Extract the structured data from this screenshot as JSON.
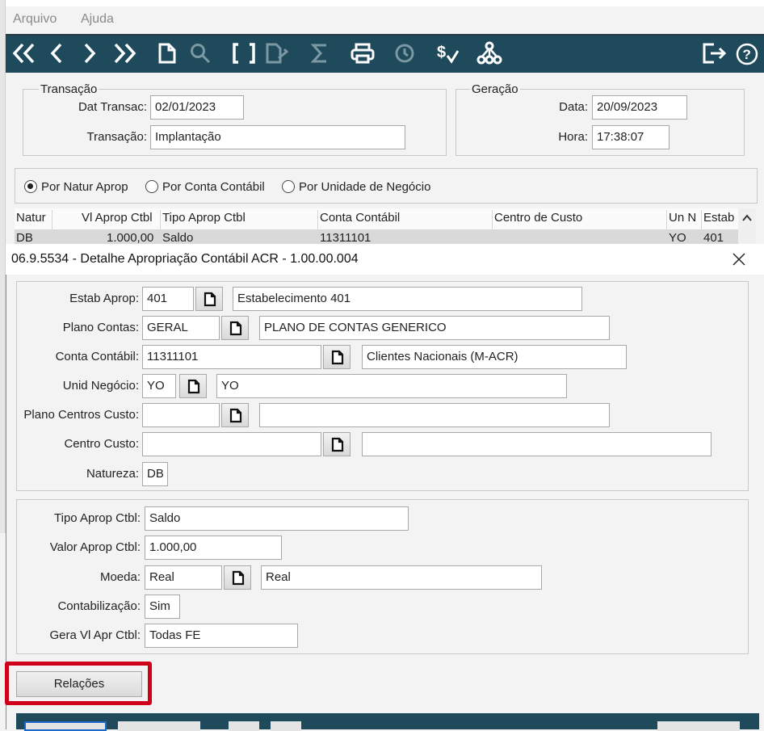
{
  "menu": {
    "file": "Arquivo",
    "help": "Ajuda"
  },
  "toolbar": {
    "icons": [
      "first-icon",
      "prev-icon",
      "next-icon",
      "last-icon",
      "new-doc-icon",
      "search-icon",
      "brackets-icon",
      "edit-doc-icon",
      "sum-icon",
      "print-icon",
      "history-icon",
      "currency-icon",
      "hierarchy-icon",
      "exit-icon",
      "help-icon"
    ],
    "bg_color": "#1e4a5c"
  },
  "transacao": {
    "legend": "Transação",
    "dat_label": "Dat Transac:",
    "dat_value": "02/01/2023",
    "trans_label": "Transação:",
    "trans_value": "Implantação"
  },
  "geracao": {
    "legend": "Geração",
    "data_label": "Data:",
    "data_value": "20/09/2023",
    "hora_label": "Hora:",
    "hora_value": "17:38:07"
  },
  "radios": [
    {
      "label": "Por Natur Aprop",
      "selected": true
    },
    {
      "label": "Por Conta Contábil",
      "selected": false
    },
    {
      "label": "Por Unidade de Negócio",
      "selected": false
    }
  ],
  "grid": {
    "headers": [
      "Natur",
      "Vl Aprop Ctbl",
      "Tipo Aprop Ctbl",
      "Conta Contábil",
      "Centro de Custo",
      "Un N",
      "Estab"
    ],
    "row": [
      "DB",
      "1.000,00",
      "Saldo",
      "11311101",
      "",
      "YO",
      "401"
    ]
  },
  "dialog": {
    "title": "06.9.5534 - Detalhe Apropriação Contábil ACR - 1.00.00.004",
    "estab_label": "Estab Aprop:",
    "estab_code": "401",
    "estab_desc": "Estabelecimento 401",
    "plano_label": "Plano Contas:",
    "plano_code": "GERAL",
    "plano_desc": "PLANO DE CONTAS GENERICO",
    "conta_label": "Conta Contábil:",
    "conta_code": "11311101",
    "conta_desc": "Clientes Nacionais (M-ACR)",
    "unid_label": "Unid Negócio:",
    "unid_code": "YO",
    "unid_desc": "YO",
    "plano_cc_label": "Plano Centros Custo:",
    "plano_cc_code": "",
    "plano_cc_desc": "",
    "cc_label": "Centro Custo:",
    "cc_code": "",
    "cc_desc": "",
    "natureza_label": "Natureza:",
    "natureza_value": "DB",
    "tipo_label": "Tipo Aprop Ctbl:",
    "tipo_value": "Saldo",
    "valor_label": "Valor Aprop Ctbl:",
    "valor_value": "1.000,00",
    "moeda_label": "Moeda:",
    "moeda_code": "Real",
    "moeda_desc": "Real",
    "contab_label": "Contabilização:",
    "contab_value": "Sim",
    "gera_label": "Gera Vl Apr Ctbl:",
    "gera_value": "Todas FE",
    "relacoes_label": "Relações",
    "highlight_color": "#d0021b"
  }
}
